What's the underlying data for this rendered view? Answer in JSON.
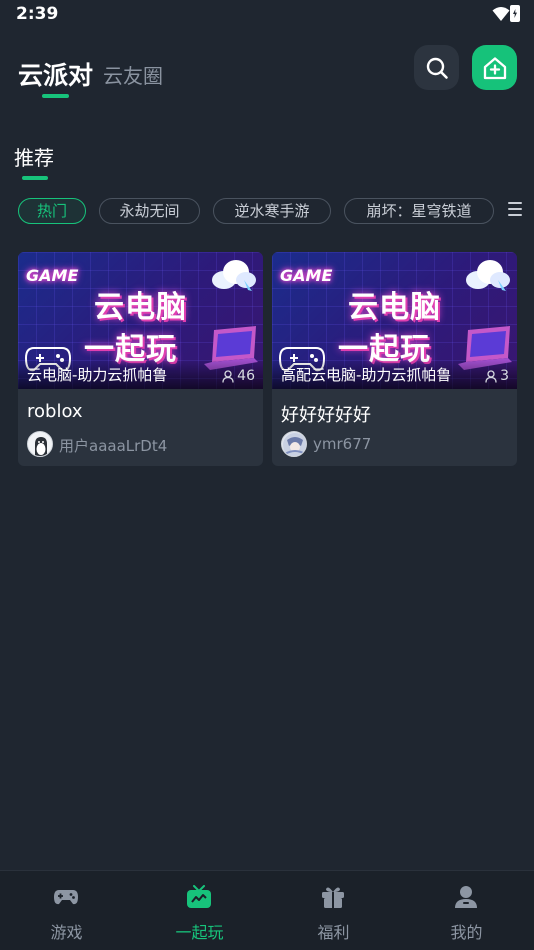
{
  "status_bar": {
    "time": "2:39"
  },
  "header": {
    "tab_active": "云派对",
    "tab_inactive": "云友圈"
  },
  "section": {
    "title": "推荐"
  },
  "chips": [
    {
      "label": "热门",
      "active": true
    },
    {
      "label": "永劫无间",
      "active": false
    },
    {
      "label": "逆水寒手游",
      "active": false
    },
    {
      "label": "崩坏：星穹铁道",
      "active": false
    }
  ],
  "thumbnail_text": {
    "badge": "GAME",
    "line1": "云电脑",
    "line2": "一起玩"
  },
  "rooms": [
    {
      "room_name": "云电脑-助力云抓帕鲁",
      "member_count": "46",
      "title": "roblox",
      "user": "用户aaaaLrDt4"
    },
    {
      "room_name": "高配云电脑-助力云抓帕鲁",
      "member_count": "3",
      "title": "好好好好好",
      "user": "ymr677"
    }
  ],
  "bottom_nav": [
    {
      "label": "游戏",
      "icon": "gamepad-icon",
      "active": false
    },
    {
      "label": "一起玩",
      "icon": "tv-icon",
      "active": true
    },
    {
      "label": "福利",
      "icon": "gift-icon",
      "active": false
    },
    {
      "label": "我的",
      "icon": "profile-icon",
      "active": false
    }
  ],
  "colors": {
    "accent": "#17c37b",
    "background": "#1f2630",
    "card": "#2b333e"
  }
}
